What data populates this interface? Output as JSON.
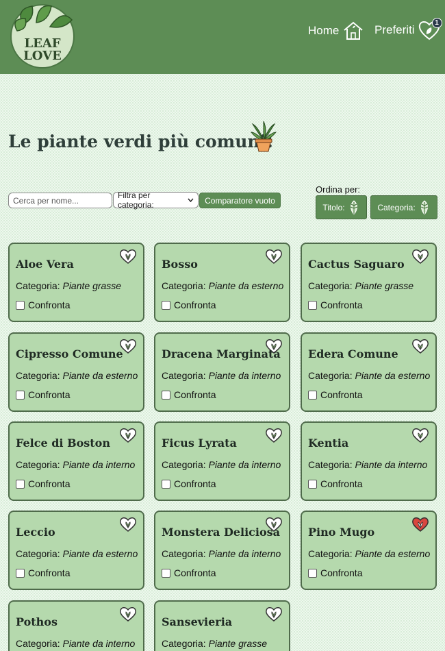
{
  "header": {
    "logo_line1": "LEAF",
    "logo_line2": "LOVE",
    "nav_home": "Home",
    "nav_favorites": "Preferiti",
    "favorites_count": "1",
    "colors": {
      "header_bg": "#5d8d55"
    }
  },
  "page": {
    "title": "Le piante verdi più comuni!"
  },
  "controls": {
    "search_placeholder": "Cerca per nome...",
    "filter_label": "Filtra per categoria:",
    "compare_label": "Comparatore vuoto",
    "sort_label": "Ordina per:",
    "sort_title": "Titolo:",
    "sort_category": "Categoria:"
  },
  "card_labels": {
    "category_prefix": "Categoria:",
    "compare": "Confronta"
  },
  "plants": [
    {
      "name": "Aloe Vera",
      "category": "Piante grasse",
      "favorite": false
    },
    {
      "name": "Bosso",
      "category": "Piante da esterno",
      "favorite": false
    },
    {
      "name": "Cactus Saguaro",
      "category": "Piante grasse",
      "favorite": false
    },
    {
      "name": "Cipresso Comune",
      "category": "Piante da esterno",
      "favorite": false
    },
    {
      "name": "Dracena Marginata",
      "category": "Piante da interno",
      "favorite": false
    },
    {
      "name": "Edera Comune",
      "category": "Piante da esterno",
      "favorite": false
    },
    {
      "name": "Felce di Boston",
      "category": "Piante da interno",
      "favorite": false
    },
    {
      "name": "Ficus Lyrata",
      "category": "Piante da interno",
      "favorite": false
    },
    {
      "name": "Kentia",
      "category": "Piante da interno",
      "favorite": false
    },
    {
      "name": "Leccio",
      "category": "Piante da esterno",
      "favorite": false
    },
    {
      "name": "Monstera Deliciosa",
      "category": "Piante da interno",
      "favorite": false
    },
    {
      "name": "Pino Mugo",
      "category": "Piante da esterno",
      "favorite": true
    },
    {
      "name": "Pothos",
      "category": "Piante da interno",
      "favorite": false
    },
    {
      "name": "Sansevieria",
      "category": "Piante grasse",
      "favorite": false
    }
  ],
  "colors": {
    "card_bg": "#b5d9ad",
    "accent": "#5d8d55",
    "favorite_heart": "#d9463e"
  }
}
